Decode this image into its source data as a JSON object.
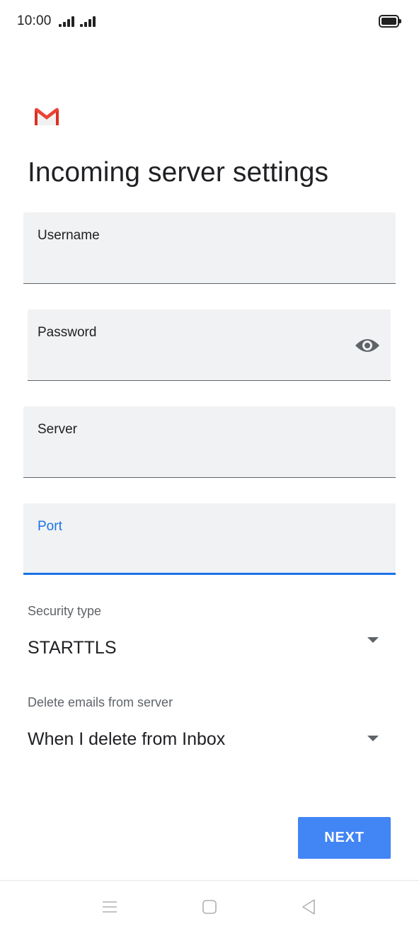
{
  "status_bar": {
    "time": "10:00"
  },
  "header": {
    "logo_icon": "gmail-logo-icon",
    "title": "Incoming server settings"
  },
  "form": {
    "username": {
      "label": "Username",
      "value": ""
    },
    "password": {
      "label": "Password",
      "value": "",
      "toggle_icon": "eye-icon"
    },
    "server": {
      "label": "Server",
      "value": ""
    },
    "port": {
      "label": "Port",
      "value": "",
      "focused": true
    }
  },
  "security_type": {
    "label": "Security type",
    "selected": "STARTTLS"
  },
  "delete_emails": {
    "label": "Delete emails from server",
    "selected": "When I delete from Inbox"
  },
  "actions": {
    "next_label": "NEXT"
  },
  "nav_bar": {
    "menu_icon": "menu-icon",
    "home_icon": "home-icon",
    "back_icon": "back-icon"
  },
  "colors": {
    "accent": "#1a73e8",
    "button": "#4285f4",
    "field_bg": "#f1f2f3",
    "gmail_red": "#d93025"
  }
}
